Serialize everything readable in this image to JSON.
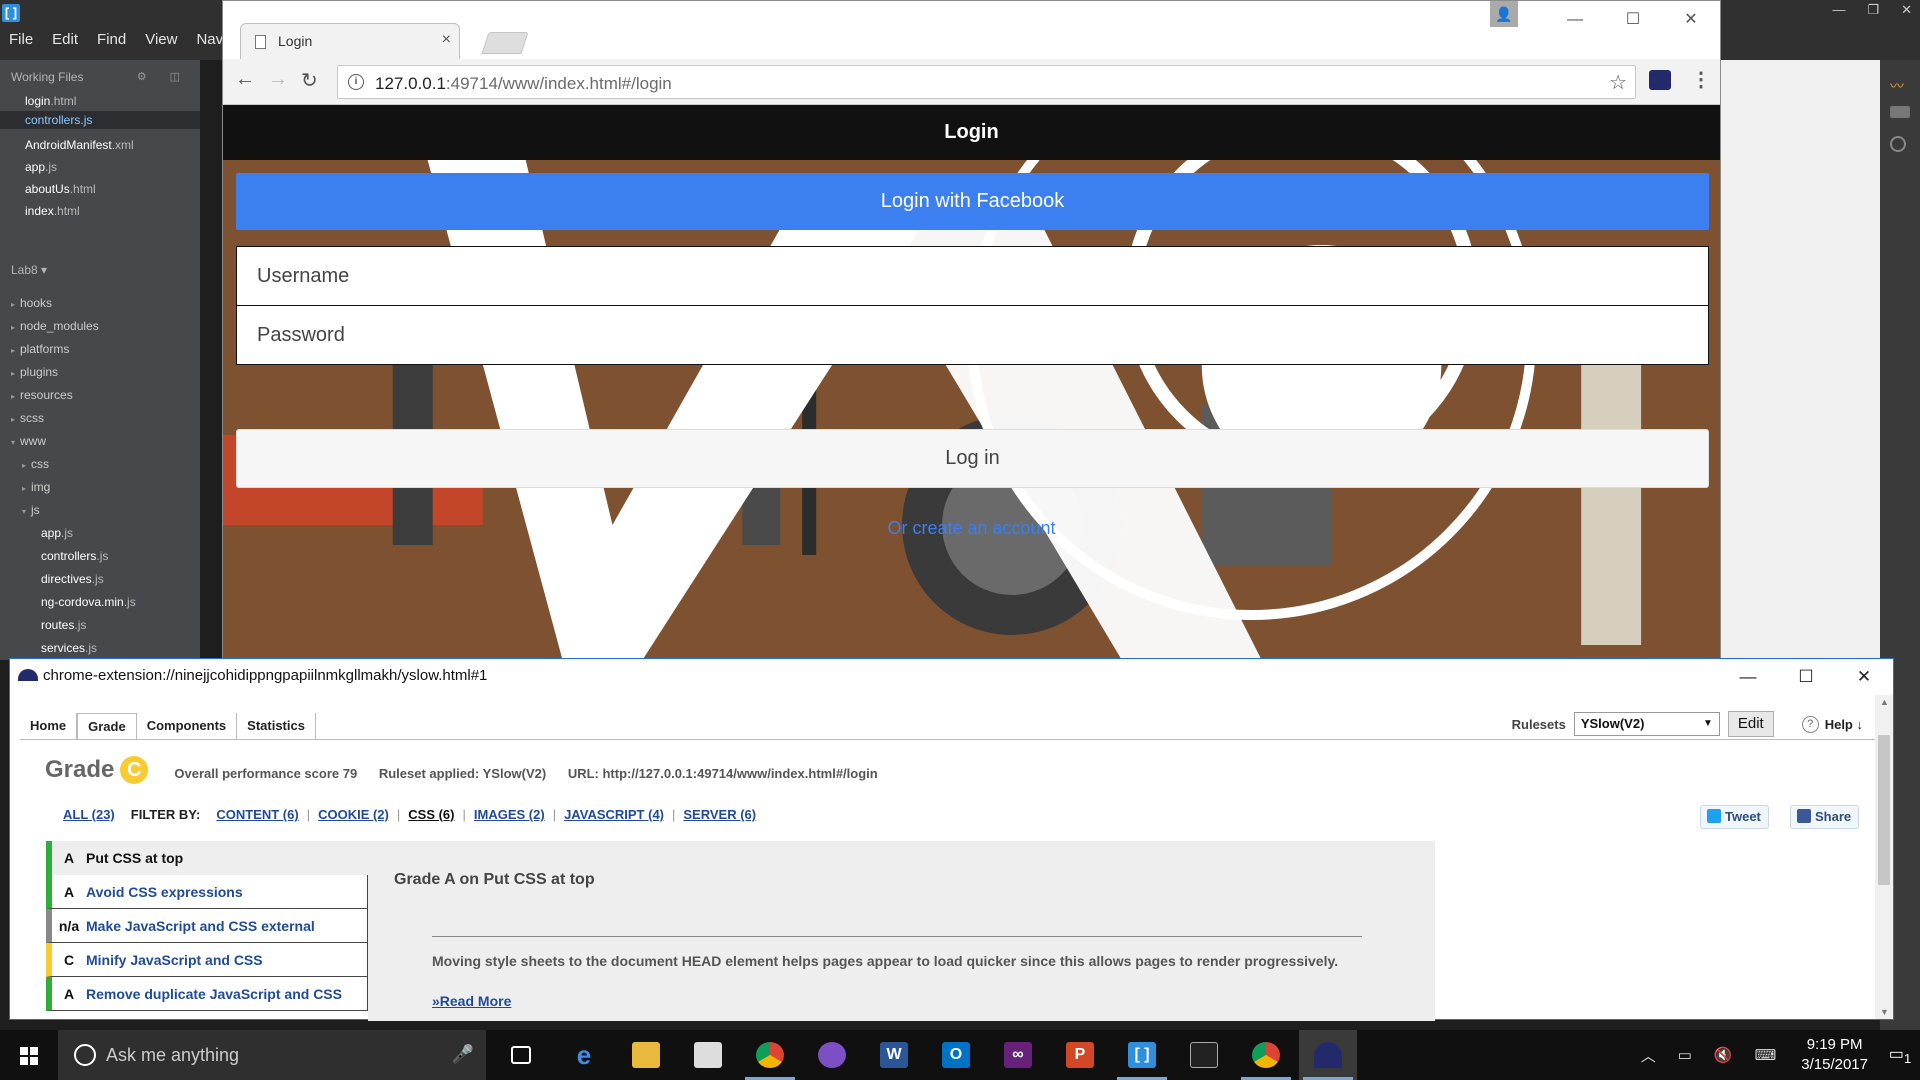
{
  "editor": {
    "menu": [
      "File",
      "Edit",
      "Find",
      "View",
      "Navig"
    ],
    "working_files_title": "Working Files",
    "working_files": [
      {
        "name": "login",
        "ext": ".html"
      },
      {
        "name": "controllers",
        "ext": ".js"
      },
      {
        "name": "AndroidManifest",
        "ext": ".xml"
      },
      {
        "name": "app",
        "ext": ".js"
      },
      {
        "name": "aboutUs",
        "ext": ".html"
      },
      {
        "name": "index",
        "ext": ".html"
      }
    ],
    "project_title": "Lab8 ▾",
    "tree": [
      {
        "name": "hooks",
        "ext": ""
      },
      {
        "name": "node_modules",
        "ext": ""
      },
      {
        "name": "platforms",
        "ext": ""
      },
      {
        "name": "plugins",
        "ext": ""
      },
      {
        "name": "resources",
        "ext": ""
      },
      {
        "name": "scss",
        "ext": ""
      },
      {
        "name": "www",
        "ext": ""
      },
      {
        "name": "css",
        "ext": ""
      },
      {
        "name": "img",
        "ext": ""
      },
      {
        "name": "js",
        "ext": ""
      },
      {
        "name": "app",
        "ext": ".js"
      },
      {
        "name": "controllers",
        "ext": ".js"
      },
      {
        "name": "directives",
        "ext": ".js"
      },
      {
        "name": "ng-cordova.min",
        "ext": ".js"
      },
      {
        "name": "routes",
        "ext": ".js"
      },
      {
        "name": "services",
        "ext": ".js"
      }
    ]
  },
  "browser": {
    "tab_title": "Login",
    "url_host": "127.0.0.1",
    "url_rest": ":49714/www/index.html#/login"
  },
  "app": {
    "header_title": "Login",
    "facebook_button": "Login with Facebook",
    "username_placeholder": "Username",
    "password_placeholder": "Password",
    "login_button": "Log in",
    "create_account_link": "Or create an account"
  },
  "yslow": {
    "window_title": "chrome-extension://ninejjcohidippngpapiilnmkgllmakh/yslow.html#1",
    "tabs": [
      "Home",
      "Grade",
      "Components",
      "Statistics"
    ],
    "rulesets_label": "Rulesets",
    "ruleset_value": "YSlow(V2)",
    "edit_button": "Edit",
    "help_label": "Help ↓",
    "grade_label": "Grade",
    "grade_letter": "C",
    "score_text": "Overall performance score 79",
    "ruleset_applied": "Ruleset applied: YSlow(V2)",
    "url_text": "URL: http://127.0.0.1:49714/www/index.html#/login",
    "filter_all": "ALL (23)",
    "filter_by": "FILTER BY:",
    "filters": [
      "CONTENT (6)",
      "COOKIE (2)",
      "CSS (6)",
      "IMAGES (2)",
      "JAVASCRIPT (4)",
      "SERVER (6)"
    ],
    "tweet": "Tweet",
    "share": "Share",
    "rules": [
      {
        "grade": "A",
        "name": "Put CSS at top",
        "color": "#2eae3a"
      },
      {
        "grade": "A",
        "name": "Avoid CSS expressions",
        "color": "#2eae3a"
      },
      {
        "grade": "n/a",
        "name": "Make JavaScript and CSS external",
        "color": "#888888"
      },
      {
        "grade": "C",
        "name": "Minify JavaScript and CSS",
        "color": "#f7cc32"
      },
      {
        "grade": "A",
        "name": "Remove duplicate JavaScript and CSS",
        "color": "#2eae3a"
      }
    ],
    "detail_heading": "Grade A on Put CSS at top",
    "detail_text": "Moving style sheets to the document HEAD element helps pages appear to load quicker since this allows pages to render progressively.",
    "read_more": "»Read More"
  },
  "taskbar": {
    "search_placeholder": "Ask me anything",
    "time": "9:19 PM",
    "date": "3/15/2017",
    "notif_count": "1",
    "apps": [
      "task-view",
      "edge",
      "file-explorer",
      "store",
      "chrome",
      "github",
      "word",
      "outlook",
      "visual-studio",
      "powerpoint",
      "brackets",
      "cmd",
      "chrome-2",
      "yslow"
    ]
  }
}
